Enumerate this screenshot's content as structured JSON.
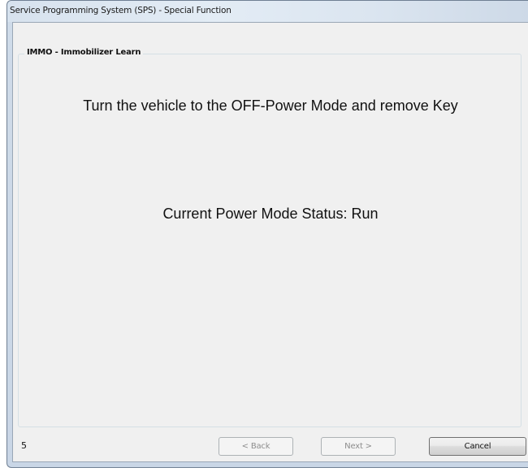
{
  "window": {
    "title": "Service Programming System (SPS) - Special Function"
  },
  "group": {
    "title": "IMMO - Immobilizer Learn"
  },
  "instructions": {
    "line1": "Turn the vehicle to the OFF-Power Mode and remove Key",
    "line2": "Current Power Mode Status: Run"
  },
  "footer": {
    "step_number": "5",
    "back_label": "< Back",
    "next_label": "Next >",
    "cancel_label": "Cancel"
  }
}
